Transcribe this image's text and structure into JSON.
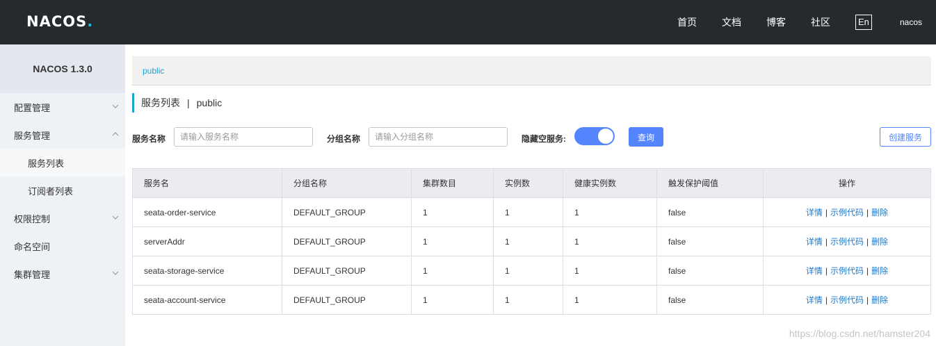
{
  "header": {
    "logo_text": "NACOS",
    "logo_dot": ".",
    "nav": [
      "首页",
      "文档",
      "博客",
      "社区"
    ],
    "lang": "En",
    "user": "nacos"
  },
  "sidebar": {
    "title": "NACOS 1.3.0",
    "items": [
      {
        "label": "配置管理"
      },
      {
        "label": "服务管理"
      },
      {
        "label": "服务列表"
      },
      {
        "label": "订阅者列表"
      },
      {
        "label": "权限控制"
      },
      {
        "label": "命名空间"
      },
      {
        "label": "集群管理"
      }
    ]
  },
  "breadcrumb": "public",
  "page_title": {
    "title": "服务列表",
    "separator": "|",
    "namespace": "public"
  },
  "filters": {
    "service_name_label": "服务名称",
    "service_name_placeholder": "请输入服务名称",
    "group_name_label": "分组名称",
    "group_name_placeholder": "请输入分组名称",
    "hide_empty_label": "隐藏空服务:",
    "hide_empty_on": true,
    "query_button": "查询",
    "create_button": "创建服务"
  },
  "table": {
    "columns": [
      "服务名",
      "分组名称",
      "集群数目",
      "实例数",
      "健康实例数",
      "触发保护阈值",
      "操作"
    ],
    "rows": [
      [
        "seata-order-service",
        "DEFAULT_GROUP",
        "1",
        "1",
        "1",
        "false"
      ],
      [
        "serverAddr",
        "DEFAULT_GROUP",
        "1",
        "1",
        "1",
        "false"
      ],
      [
        "seata-storage-service",
        "DEFAULT_GROUP",
        "1",
        "1",
        "1",
        "false"
      ],
      [
        "seata-account-service",
        "DEFAULT_GROUP",
        "1",
        "1",
        "1",
        "false"
      ]
    ],
    "actions": {
      "detail": "详情",
      "sample": "示例代码",
      "delete": "删除",
      "separator": "|"
    }
  },
  "watermark": "https://blog.csdn.net/hamster204",
  "colors": {
    "topbar": "#252a2f",
    "accent": "#5584ff",
    "link": "#1e78c8",
    "breadcrumb": "#1ea2c9"
  }
}
